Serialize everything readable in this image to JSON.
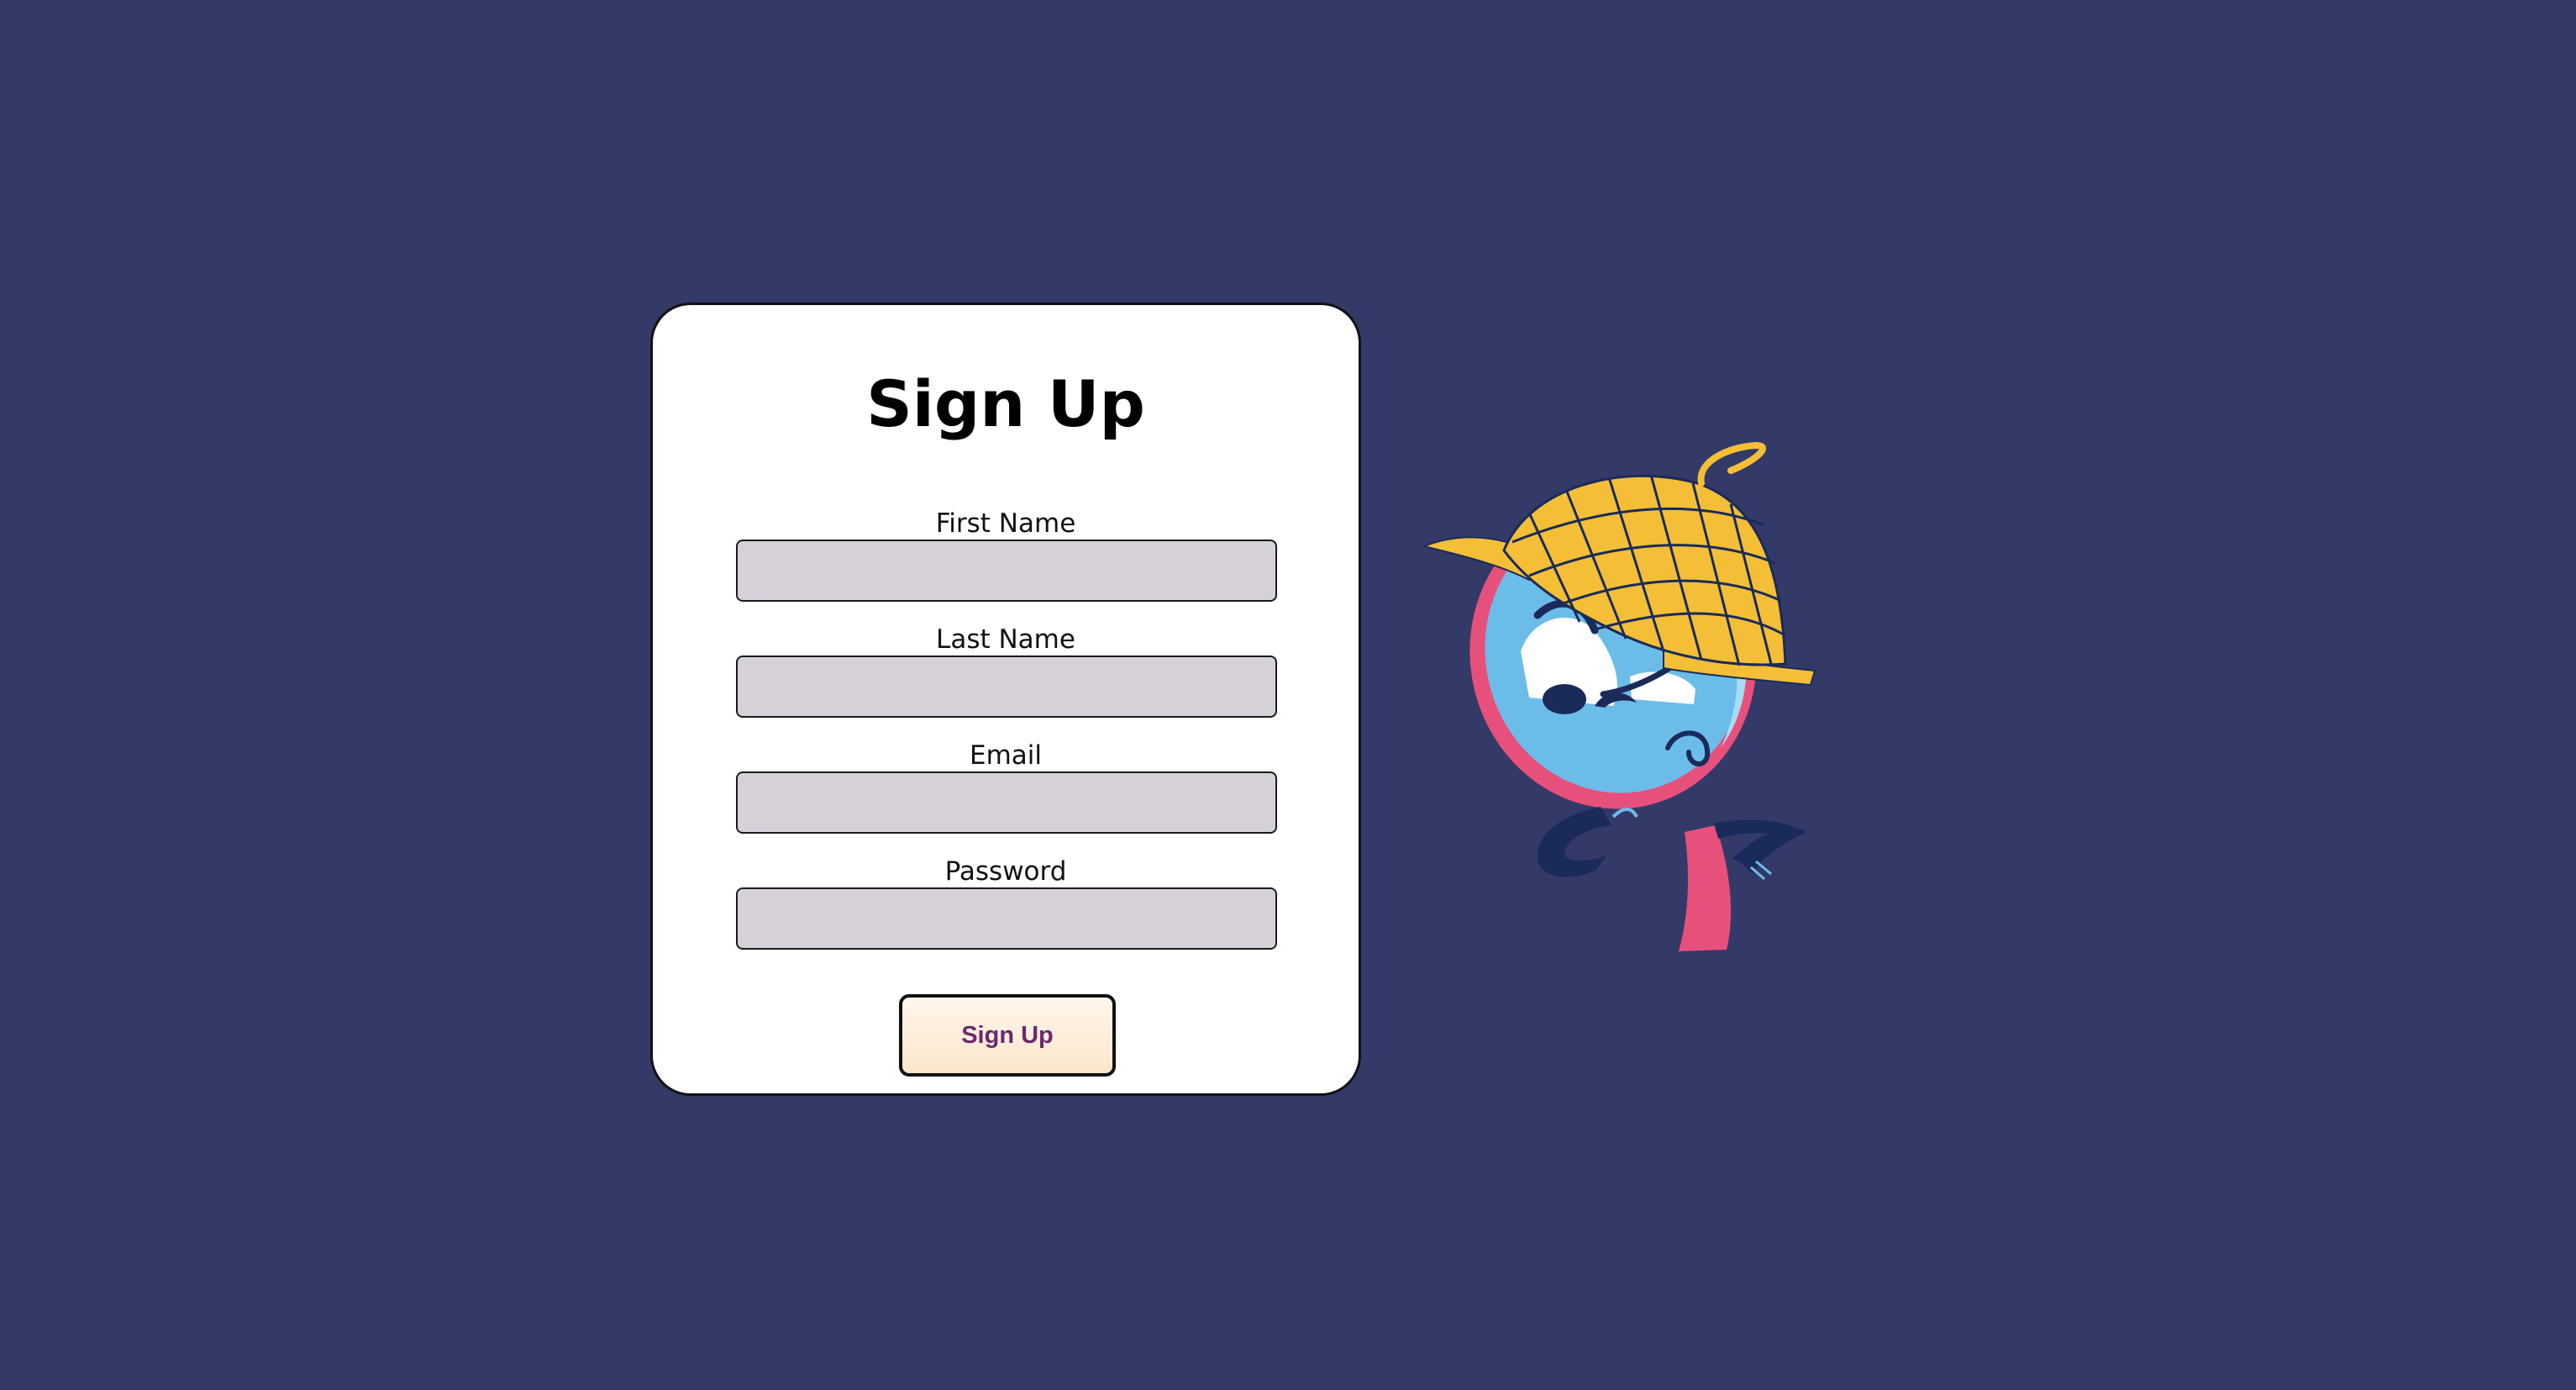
{
  "form": {
    "title": "Sign Up",
    "fields": [
      {
        "label": "First Name",
        "value": "",
        "placeholder": ""
      },
      {
        "label": "Last Name",
        "value": "",
        "placeholder": ""
      },
      {
        "label": "Email",
        "value": "",
        "placeholder": ""
      },
      {
        "label": "Password",
        "value": "",
        "placeholder": ""
      }
    ],
    "submit_label": "Sign Up"
  },
  "mascot": {
    "icon": "detective-magnifier-mascot"
  },
  "colors": {
    "background": "#333a68",
    "card": "#ffffff",
    "input_fill": "#d6d1d9",
    "button_text": "#6a2a6e",
    "mascot_blue": "#6cbcea",
    "mascot_pink": "#e8507c",
    "mascot_hat": "#f4bf36",
    "mascot_navy": "#1a2b5a"
  }
}
